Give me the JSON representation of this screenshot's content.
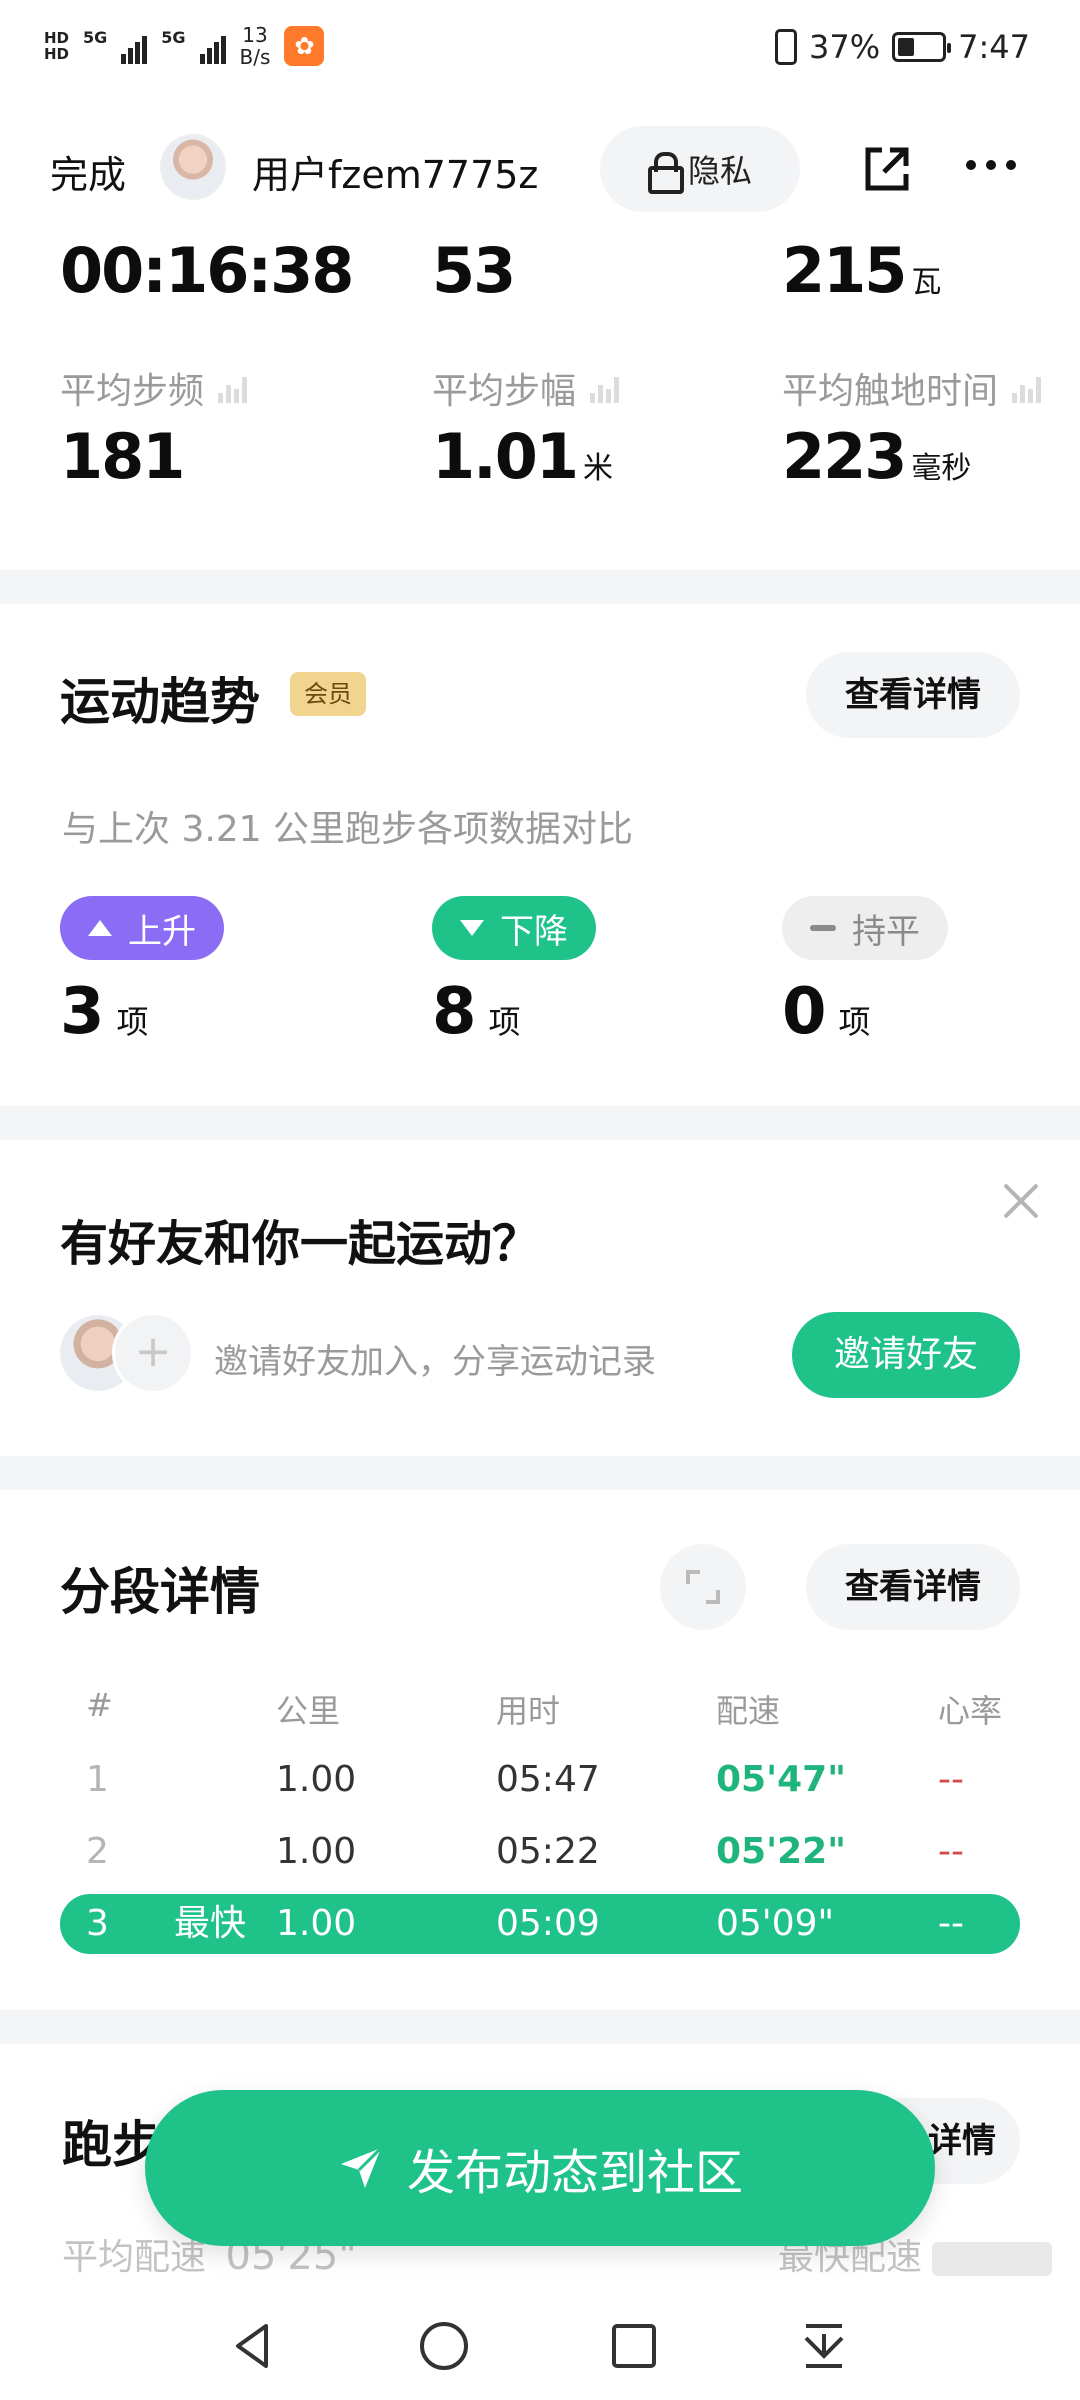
{
  "status_bar": {
    "network_hd1": "HD",
    "network_hd2": "HD",
    "net1": "5G",
    "net2": "5G",
    "speed_value": "13",
    "speed_unit": "B/s",
    "battery": "37%",
    "battery_level": 0.37,
    "time": "7:47"
  },
  "header": {
    "done_label": "完成",
    "username": "用户fzem7775z",
    "privacy_label": "隐私"
  },
  "metrics": {
    "duration": "00:16:38",
    "top_mid_value": "53",
    "power_value": "215",
    "power_unit": "瓦",
    "cadence_label": "平均步频",
    "cadence_value": "181",
    "stride_label": "平均步幅",
    "stride_value": "1.01",
    "stride_unit": "米",
    "contact_label": "平均触地时间",
    "contact_value": "223",
    "contact_unit": "毫秒"
  },
  "trend": {
    "title": "运动趋势",
    "badge": "会员",
    "details_label": "查看详情",
    "compare_text": "与上次 3.21 公里跑步各项数据对比",
    "up_label": "上升",
    "up_count": "3",
    "down_label": "下降",
    "down_count": "8",
    "flat_label": "持平",
    "flat_count": "0",
    "count_unit": "项",
    "colors": {
      "up": "#8a6cf5",
      "down": "#1fc38a",
      "flat": "#eeeeee"
    }
  },
  "friends": {
    "title": "有好友和你一起运动？",
    "invite_text": "邀请好友加入，分享运动记录",
    "invite_button": "邀请好友"
  },
  "splits": {
    "title": "分段详情",
    "details_label": "查看详情",
    "headers": {
      "idx": "#",
      "km": "公里",
      "time": "用时",
      "pace": "配速",
      "hr": "心率"
    },
    "rows": [
      {
        "idx": "1",
        "tag": "",
        "km": "1.00",
        "time": "05:47",
        "pace": "05'47\"",
        "hr": "--"
      },
      {
        "idx": "2",
        "tag": "",
        "km": "1.00",
        "time": "05:22",
        "pace": "05'22\"",
        "hr": "--"
      },
      {
        "idx": "3",
        "tag": "最快",
        "km": "1.00",
        "time": "05:09",
        "pace": "05'09\"",
        "hr": "--"
      }
    ]
  },
  "running": {
    "title_partial": "跑步",
    "details_partial": "详情",
    "avg_pace_label": "平均配速",
    "avg_pace_value": "05'25\"",
    "fast_pace_label": "最快配速"
  },
  "publish_button": "发布动态到社区",
  "accent_color": "#1fc38a"
}
